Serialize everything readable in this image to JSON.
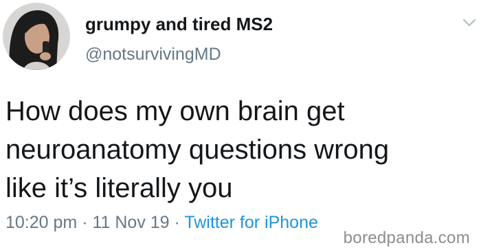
{
  "user": {
    "display_name": "grumpy and tired MS2",
    "handle": "@notsurvivingMD"
  },
  "tweet": {
    "lines": [
      "How does my own brain get",
      "neuroanatomy questions wrong",
      "like it’s literally you"
    ],
    "time": "10:20 pm",
    "date": "11 Nov 19",
    "separator": " · ",
    "source": "Twitter for iPhone"
  },
  "watermark": "boredpanda.com",
  "icons": {
    "menu": "chevron-down-icon"
  },
  "colors": {
    "text": "#14171a",
    "secondary": "#657786",
    "link": "#1b95e0"
  }
}
